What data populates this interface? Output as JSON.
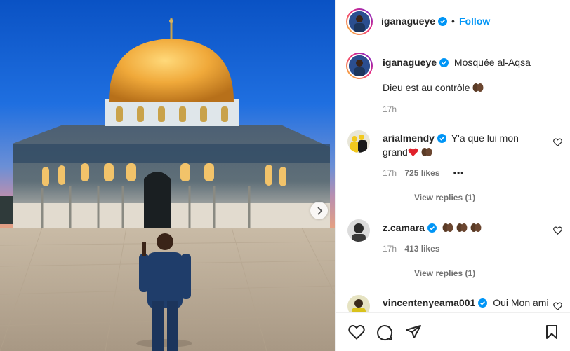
{
  "post": {
    "author": "iganagueye",
    "follow_label": "Follow",
    "separator": "•",
    "caption_location": "Mosquée al-Aqsa",
    "caption_text": "Dieu est au contrôle",
    "caption_time": "17h"
  },
  "comments": [
    {
      "username": "arialmendy",
      "text_line1": "Y'a que lui mon",
      "text_line2": "grand",
      "time": "17h",
      "likes": "725 likes",
      "more": "•••",
      "view_replies": "View replies (1)"
    },
    {
      "username": "z.camara",
      "text": "",
      "time": "17h",
      "likes": "413 likes",
      "view_replies": "View replies (1)"
    },
    {
      "username": "vincentenyeama001",
      "text": "Oui Mon ami"
    }
  ],
  "icons": {
    "verified": "verified-badge-icon",
    "like": "heart-icon",
    "comment": "comment-icon",
    "share": "share-icon",
    "save": "bookmark-icon",
    "next": "chevron-right-icon"
  },
  "colors": {
    "accent": "#0095f6",
    "text": "#262626",
    "muted": "#8e8e8e",
    "border": "#efefef"
  }
}
